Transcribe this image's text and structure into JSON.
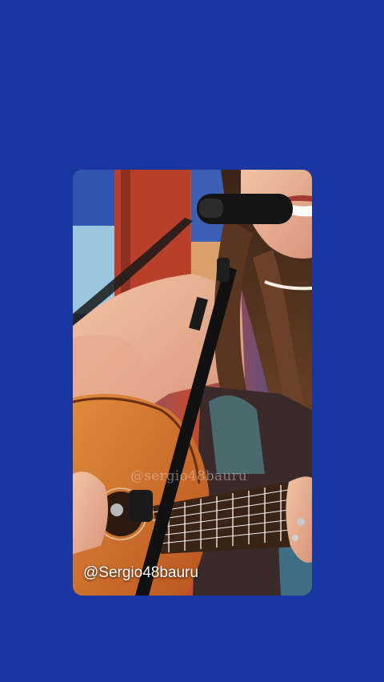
{
  "background_color": "#1b36a0",
  "photo": {
    "subject": "person-singing-with-acoustic-guitar",
    "watermark_text": "@sergio48bauru",
    "overlay_handle": "@Sergio48bauru"
  }
}
